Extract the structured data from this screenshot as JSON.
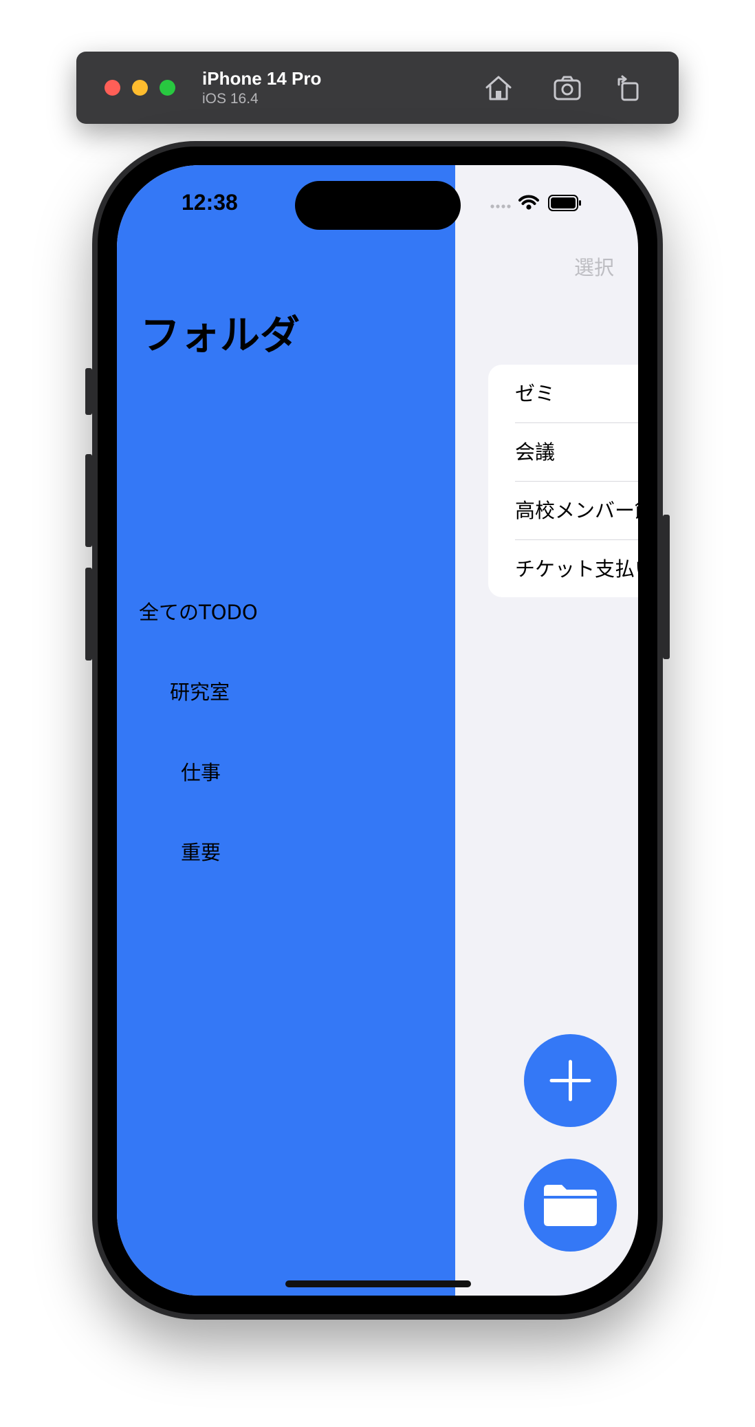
{
  "simulator": {
    "device_name": "iPhone 14 Pro",
    "os_version": "iOS 16.4",
    "icons": [
      "home-icon",
      "screenshot-icon",
      "rotate-icon"
    ]
  },
  "status_bar": {
    "time": "12:38",
    "icons": [
      "cellular-icon",
      "wifi-icon",
      "battery-icon"
    ]
  },
  "nav": {
    "select_label": "選択"
  },
  "sidebar": {
    "title": "フォルダ",
    "items": [
      {
        "label": "全てのTODO"
      },
      {
        "label": "研究室"
      },
      {
        "label": "仕事"
      },
      {
        "label": "重要"
      }
    ]
  },
  "list": {
    "items": [
      {
        "label": "ゼミ"
      },
      {
        "label": "会議"
      },
      {
        "label": "高校メンバー飲み会"
      },
      {
        "label": "チケット支払い"
      }
    ]
  },
  "buttons": {
    "add_icon": "plus-icon",
    "folder_icon": "folder-icon"
  },
  "colors": {
    "accent": "#3478f6",
    "background": "#f2f2f7"
  }
}
